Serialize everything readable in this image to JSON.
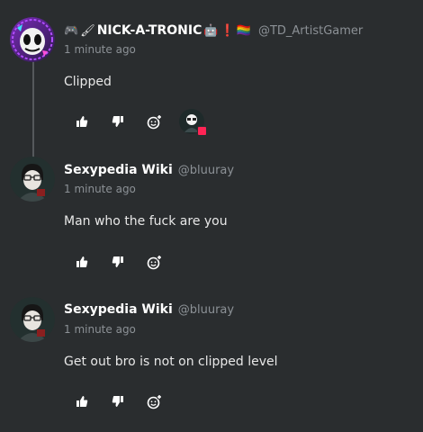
{
  "comments": [
    {
      "display_name": "NICK-A-TRONIC",
      "handle": "@TD_ArtistGamer",
      "timestamp": "1 minute ago",
      "body": "Clipped",
      "name_emojis_before": [
        "🎮",
        "🖌"
      ],
      "name_emojis_after": [
        "🤖",
        "❗",
        "🏳‍🌈"
      ]
    },
    {
      "display_name": "Sexypedia Wiki",
      "handle": "@bluuray",
      "timestamp": "1 minute ago",
      "body": "Man who the fuck are you"
    },
    {
      "display_name": "Sexypedia Wiki",
      "handle": "@bluuray",
      "timestamp": "1 minute ago",
      "body": "Get out bro is not on clipped level"
    }
  ],
  "icons": {
    "like": "thumbs-up-icon",
    "dislike": "thumbs-down-icon",
    "react": "add-reaction-icon"
  },
  "colors": {
    "background": "#2a2d2f",
    "reaction_badge": "#ff2455"
  }
}
